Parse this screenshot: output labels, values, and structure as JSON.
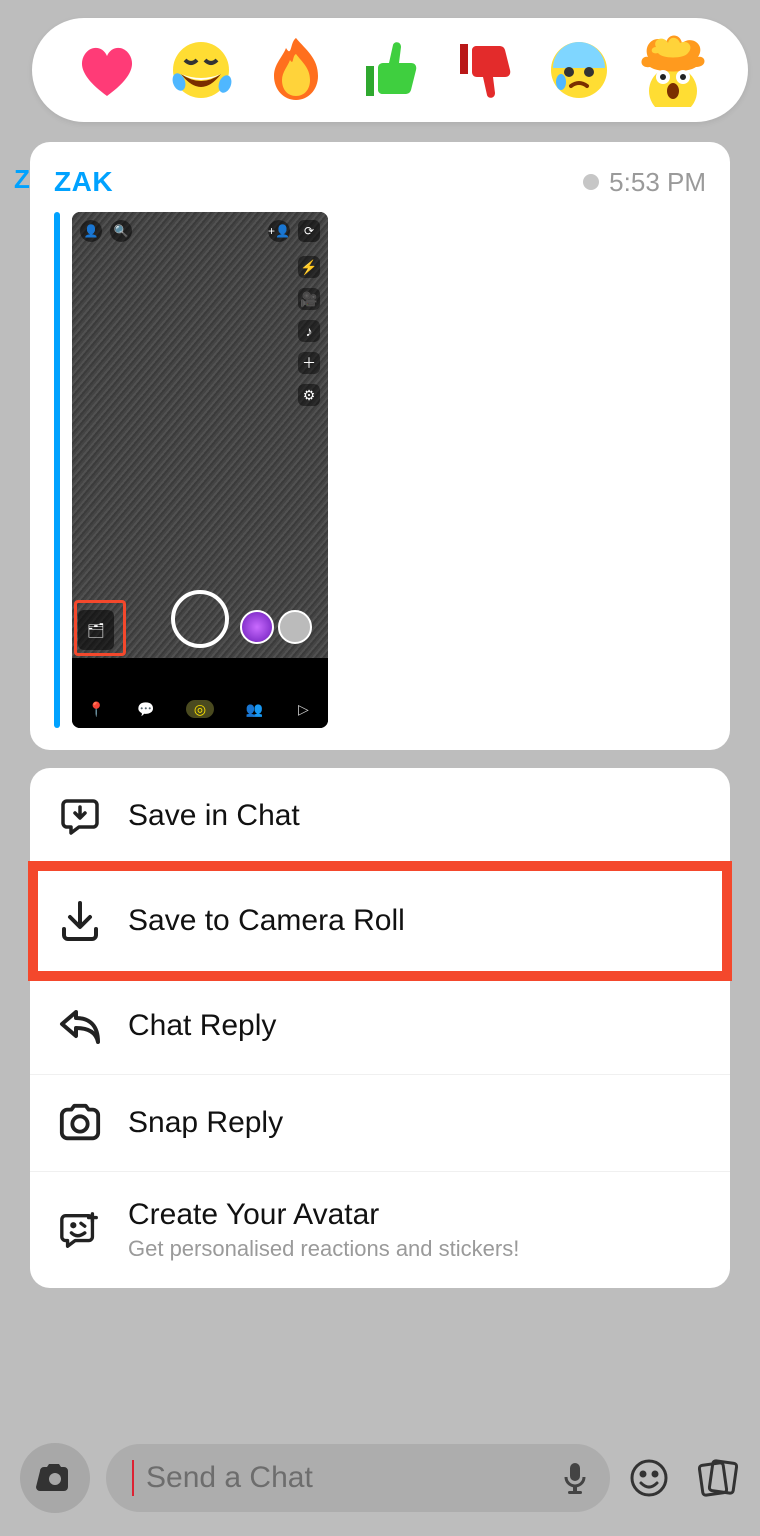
{
  "reactions": {
    "items": [
      "heart-emoji",
      "laugh-cry-emoji",
      "fire-emoji",
      "thumbs-up-emoji",
      "thumbs-down-emoji",
      "crying-emoji",
      "mind-blown-emoji"
    ]
  },
  "prev_sender_peek": "ZA",
  "message": {
    "sender": "ZAK",
    "time": "5:53 PM"
  },
  "actions": {
    "save_in_chat": "Save in Chat",
    "save_to_camera_roll": "Save to Camera Roll",
    "chat_reply": "Chat Reply",
    "snap_reply": "Snap Reply",
    "create_avatar": "Create Your Avatar",
    "create_avatar_sub": "Get personalised reactions and stickers!"
  },
  "input": {
    "placeholder": "Send a Chat"
  }
}
